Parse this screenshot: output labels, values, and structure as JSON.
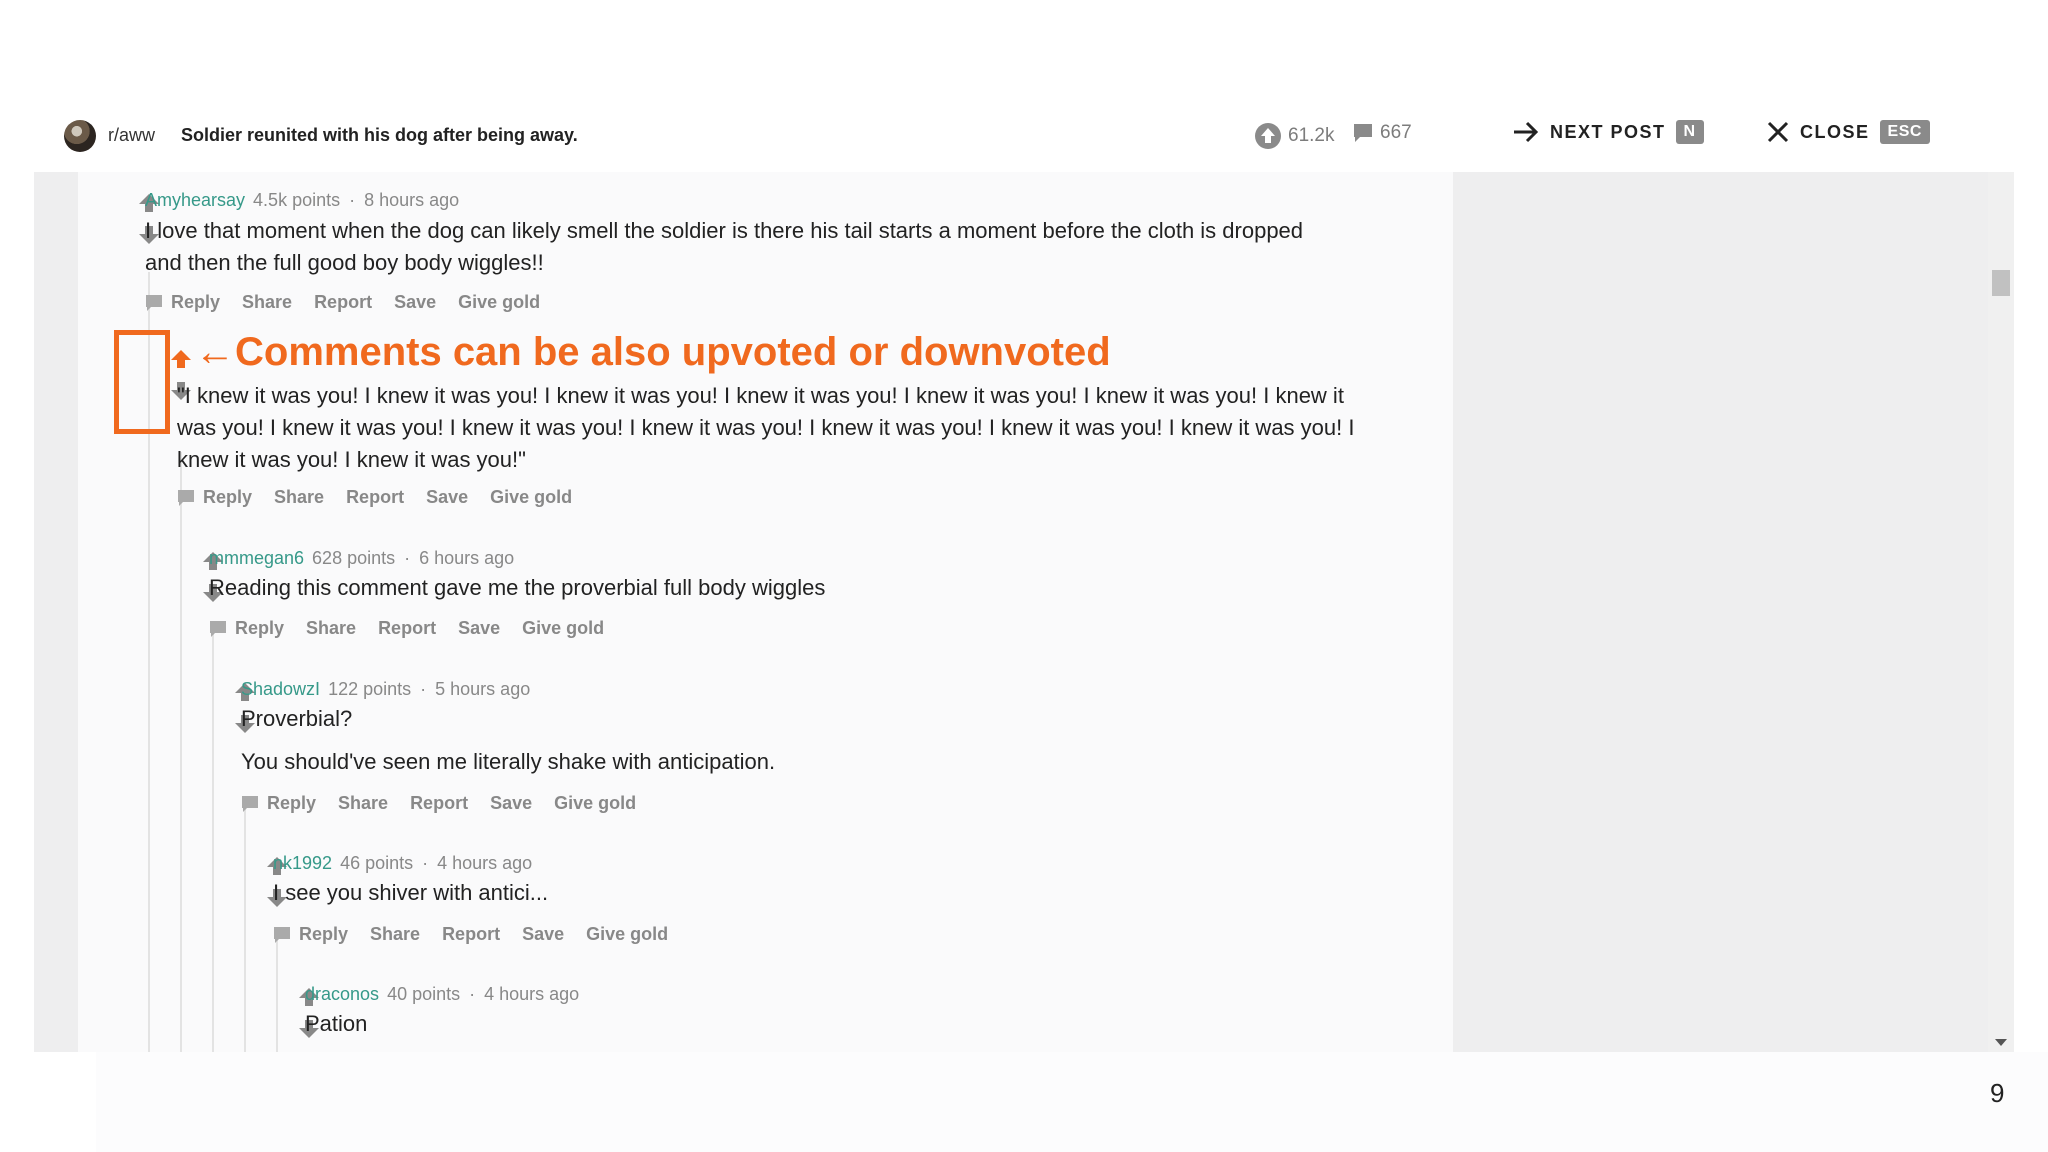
{
  "header": {
    "subreddit": "r/aww",
    "post_title": "Soldier reunited with his dog after being away.",
    "upvotes": "61.2k",
    "comment_count": "667",
    "next_post_label": "NEXT POST",
    "next_post_key": "N",
    "close_label": "CLOSE",
    "close_key": "ESC"
  },
  "action_labels": {
    "reply": "Reply",
    "share": "Share",
    "report": "Report",
    "save": "Save",
    "give_gold": "Give gold"
  },
  "annotation": "←Comments can be also upvoted or downvoted",
  "comments": [
    {
      "author": "Amyhearsay",
      "points": "4.5k points",
      "time": "8 hours ago",
      "text": "I love that moment when the dog can likely smell the soldier is there his tail starts a moment before the cloth is dropped and then the full good boy body wiggles!!"
    },
    {
      "author": "",
      "points": "",
      "time": "",
      "text": "\"I knew it was you! I knew it was you! I knew it was you! I knew it was you! I knew it was you! I knew it was you! I knew it was you! I knew it was you! I knew it was you! I knew it was you! I knew it was you! I knew it was you! I knew it was you! I knew it was you! I knew it was you!\""
    },
    {
      "author": "mmmegan6",
      "points": "628 points",
      "time": "6 hours ago",
      "text": "Reading this comment gave me the proverbial full body wiggles"
    },
    {
      "author": "ShadowzI",
      "points": "122 points",
      "time": "5 hours ago",
      "text": "Proverbial?",
      "text2": "You should've seen me literally shake with anticipation."
    },
    {
      "author": "nk1992",
      "points": "46 points",
      "time": "4 hours ago",
      "text": "I see you shiver with antici..."
    },
    {
      "author": "draconos",
      "points": "40 points",
      "time": "4 hours ago",
      "text": "Pation"
    }
  ],
  "page_number": "9",
  "colors": {
    "accent": "#f0691e",
    "author": "#369989",
    "meta": "#888888"
  }
}
